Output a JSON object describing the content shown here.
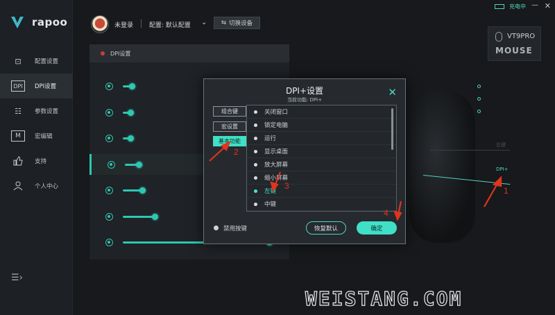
{
  "app": {
    "logo_text": "rapoo"
  },
  "sidebar": {
    "items": [
      {
        "label": "配置设置",
        "icon": "config-icon",
        "glyph": "⊡"
      },
      {
        "label": "DPI设置",
        "icon": "dpi-icon",
        "glyph": "DPI"
      },
      {
        "label": "参数设置",
        "icon": "params-icon",
        "glyph": "☷"
      },
      {
        "label": "宏编辑",
        "icon": "macro-icon",
        "glyph": "M"
      },
      {
        "label": "支持",
        "icon": "thumbs-up-icon",
        "glyph": "👍"
      },
      {
        "label": "个人中心",
        "icon": "user-icon",
        "glyph": "⚇"
      }
    ],
    "active_index": 1
  },
  "topbar": {
    "login_text": "未登录",
    "config_label": "配置: 默认配置",
    "switch_device": "切换设备",
    "battery_text": "充电中"
  },
  "dpi_panel": {
    "header": "DPI设置",
    "rows": [
      {
        "fill": 0.05,
        "selected": false
      },
      {
        "fill": 0.04,
        "selected": false
      },
      {
        "fill": 0.04,
        "selected": false
      },
      {
        "fill": 0.08,
        "selected": true
      },
      {
        "fill": 0.12,
        "selected": false
      },
      {
        "fill": 0.2,
        "selected": false
      },
      {
        "fill": 0.95,
        "selected": false
      }
    ]
  },
  "model": {
    "name": "VT9PRO",
    "type": "MOUSE"
  },
  "mouse_labels": {
    "right": "右键",
    "dpi_plus": "DPI+"
  },
  "modal": {
    "title": "DPI+设置",
    "subtitle": "当前功能: DPI+",
    "tabs": [
      "组合键",
      "宏设置",
      "基本功能"
    ],
    "active_tab": 2,
    "list": [
      "关闭窗口",
      "锁定电脑",
      "运行",
      "显示桌面",
      "放大屏幕",
      "缩小屏幕",
      "左键",
      "中键"
    ],
    "selected_item": 6,
    "disable_label": "禁用按键",
    "restore_button": "恢复默认",
    "ok_button": "确定"
  },
  "annotations": [
    "1",
    "2",
    "3",
    "4"
  ],
  "watermark": "WEISTANG.COM",
  "colors": {
    "accent": "#3fe0c6",
    "annotation": "#e0341f",
    "background": "#17191c"
  }
}
